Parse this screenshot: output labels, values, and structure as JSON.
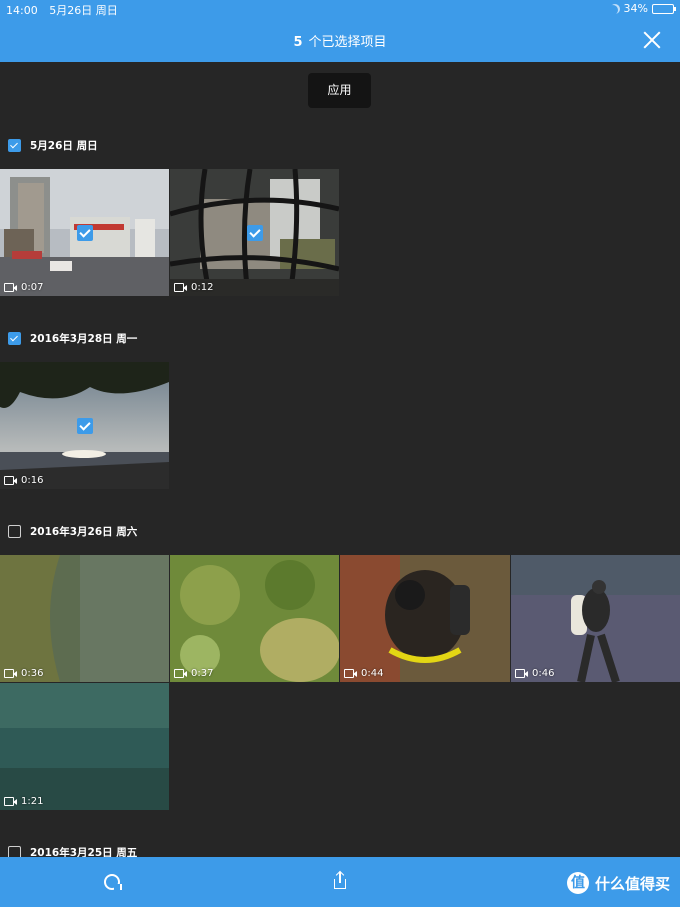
{
  "status_bar": {
    "time": "14:00",
    "date": "5月26日 周日",
    "battery": "34%",
    "battery_level": 0.34
  },
  "nav": {
    "count": "5",
    "title": "个已选择项目"
  },
  "apply_label": "应用",
  "sections": [
    {
      "date": "5月26日 周日",
      "checked": true,
      "items": [
        {
          "duration": "0:07",
          "selected": true
        },
        {
          "duration": "0:12",
          "selected": true
        }
      ]
    },
    {
      "date": "2016年3月28日 周一",
      "checked": true,
      "items": [
        {
          "duration": "0:16",
          "selected": true
        }
      ]
    },
    {
      "date": "2016年3月26日 周六",
      "checked": false,
      "items": [
        {
          "duration": "0:36",
          "selected": false
        },
        {
          "duration": "0:37",
          "selected": false
        },
        {
          "duration": "0:44",
          "selected": false
        },
        {
          "duration": "0:46",
          "selected": false
        },
        {
          "duration": "1:21",
          "selected": false
        }
      ]
    },
    {
      "date": "2016年3月25日 周五",
      "checked": false,
      "items": []
    }
  ],
  "watermark": {
    "logo": "值",
    "text": "什么值得买"
  },
  "colors": {
    "accent": "#3d9be9",
    "background": "#262626"
  }
}
